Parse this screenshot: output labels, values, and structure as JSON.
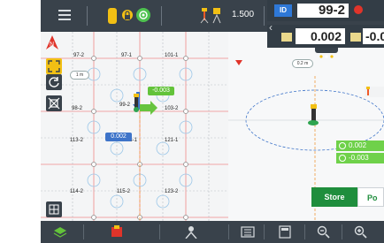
{
  "topbar": {
    "elevation": "1.500",
    "icons": [
      "menu-icon",
      "lock-icon",
      "satellite-icon",
      "prism-icon",
      "total-station-icon"
    ]
  },
  "leftmap": {
    "scale": "1 m",
    "points": [
      "97-2",
      "97-1",
      "101-1",
      "98-2",
      "99-2",
      "103-2",
      "113-2",
      "121-1",
      "114-2",
      "115-2",
      "123-2"
    ],
    "stake_label": "113-1",
    "offset_green": "-0.003",
    "offset_blue": "0.002"
  },
  "hud": {
    "id_label": "ID",
    "point_id": "99-2",
    "value1": "0.002",
    "value2": "-0.0"
  },
  "rightpanel": {
    "scale": "0.2 m",
    "deltas": [
      "0.002",
      "-0.003"
    ],
    "store_label": "Store",
    "secondary_label": "Po"
  },
  "bottombar": {
    "icons": [
      "layers-icon",
      "map-icon",
      "user-icon",
      "list-icon",
      "calculator-icon",
      "zoom-out-icon",
      "zoom-in-icon"
    ]
  },
  "colors": {
    "bar": "#39424b",
    "accent_green": "#63c33a",
    "store_green": "#1f8e3d",
    "id_blue": "#2e78d7"
  }
}
